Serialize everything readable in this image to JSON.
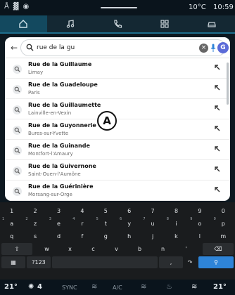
{
  "status": {
    "temperature": "10°C",
    "time": "10:59"
  },
  "search": {
    "query": "rue de la gu",
    "avatar_letter": "G"
  },
  "results": [
    {
      "name": "Rue de la Guillaume",
      "place": "Limay"
    },
    {
      "name": "Rue de la Guadeloupe",
      "place": "Paris"
    },
    {
      "name": "Rue de la Guillaumette",
      "place": "Lainville-en-Vexin"
    },
    {
      "name": "Rue de la Guyonnerie",
      "place": "Bures-sur-Yvette"
    },
    {
      "name": "Rue de la Guinande",
      "place": "Montfort-l'Amaury"
    },
    {
      "name": "Rue de la Guivernone",
      "place": "Saint-Ouen-l'Aumône"
    },
    {
      "name": "Rue de la Guérinière",
      "place": "Morsang-sur-Orge"
    }
  ],
  "callout_label": "A",
  "keyboard": {
    "row1": [
      "1",
      "2",
      "3",
      "4",
      "5",
      "6",
      "7",
      "8",
      "9",
      "0"
    ],
    "row2": [
      [
        "a",
        "1"
      ],
      [
        "z",
        "2"
      ],
      [
        "e",
        "3"
      ],
      [
        "r",
        "4"
      ],
      [
        "t",
        "5"
      ],
      [
        "y",
        "6"
      ],
      [
        "u",
        "7"
      ],
      [
        "i",
        "8"
      ],
      [
        "o",
        "9"
      ],
      [
        "p",
        "0"
      ]
    ],
    "row3": [
      "q",
      "s",
      "d",
      "f",
      "g",
      "h",
      "j",
      "k",
      "l",
      "m"
    ],
    "row4": [
      "w",
      "x",
      "c",
      "v",
      "b",
      "n",
      "'"
    ],
    "row5": {
      "symbols": "?123",
      "comma": ","
    }
  },
  "bottom": {
    "temp_left": "21°",
    "fan": "4",
    "sync": "SYNC",
    "ac": "A/C",
    "temp_right": "21°"
  },
  "colors": {
    "accent": "#2e84d8",
    "nav_active": "#13495f",
    "avatar": "#5b6bd8"
  }
}
